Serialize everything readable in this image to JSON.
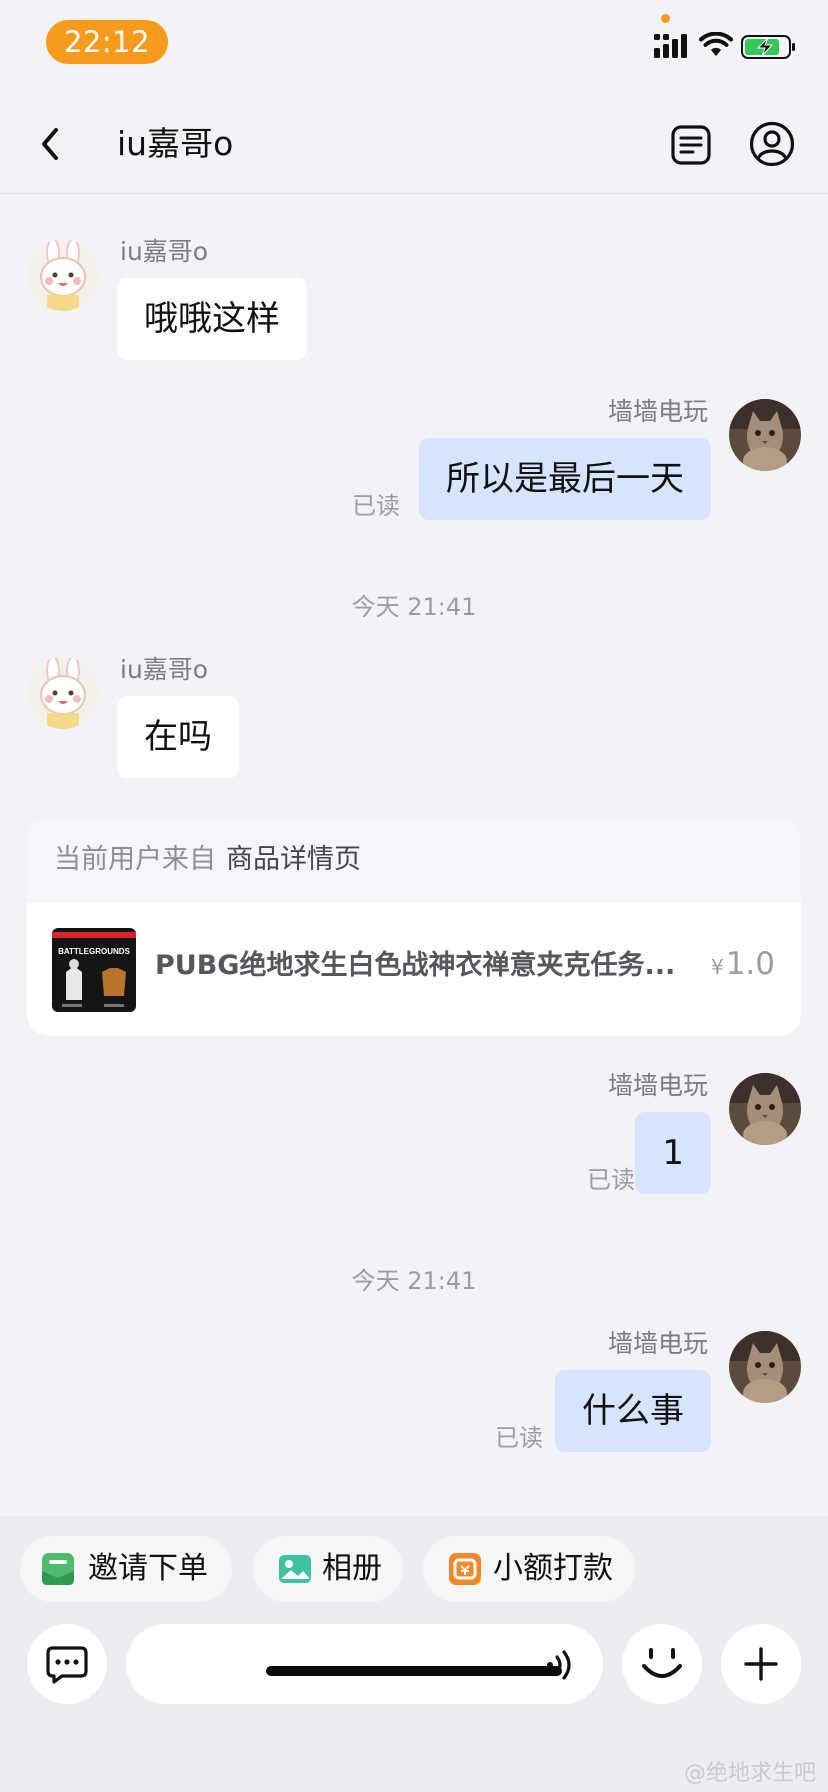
{
  "status_bar": {
    "time": "22:12"
  },
  "header": {
    "title": "iu嘉哥o"
  },
  "messages": [
    {
      "sender": "iu嘉哥o",
      "text": "哦哦这样"
    },
    {
      "sender": "墙墙电玩",
      "text": "所以是最后一天",
      "status": "已读"
    },
    {
      "timestamp": "今天 21:41"
    },
    {
      "sender": "iu嘉哥o",
      "text": "在吗"
    },
    {
      "sender": "墙墙电玩",
      "text": "1",
      "status": "已读"
    },
    {
      "timestamp": "今天 21:41"
    },
    {
      "sender": "墙墙电玩",
      "text": "什么事",
      "status": "已读"
    }
  ],
  "product_card": {
    "source_label": "当前用户来自",
    "source_page": "商品详情页",
    "title": "PUBG绝地求生白色战神衣禅意夹克任务...",
    "price_symbol": "¥",
    "price": "1.0",
    "thumb_text": "BATTLEGROUNDS"
  },
  "quick_actions": [
    {
      "label": "邀请下单",
      "icon": "order-icon",
      "color": "#4dba6c"
    },
    {
      "label": "相册",
      "icon": "album-icon",
      "color": "#3fc3a3"
    },
    {
      "label": "小额打款",
      "icon": "payment-icon",
      "color": "#f0892a"
    }
  ],
  "input": {
    "placeholder": ""
  },
  "watermark": "@绝地求生吧",
  "colors": {
    "status_time_bg": "#f79b1f",
    "outgoing_bubble": "#d5e5fd",
    "background": "#f2f3f7"
  }
}
